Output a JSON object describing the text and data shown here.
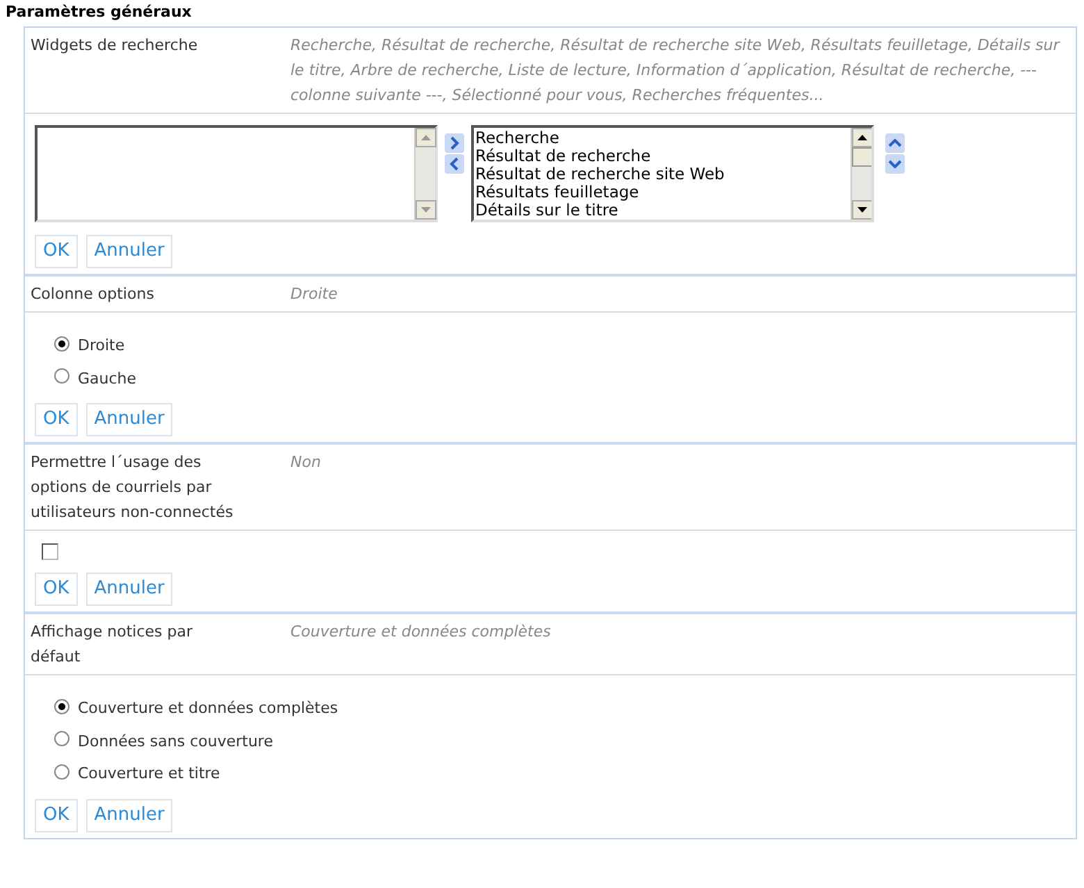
{
  "title": "Paramètres généraux",
  "sections": [
    {
      "label": "Widgets de recherche",
      "summary": "Recherche, Résultat de recherche, Résultat de recherche site Web, Résultats feuilletage, Détails sur le titre, Arbre de recherche, Liste de lecture, Information d´application, Résultat de recherche, ---colonne suivante ---, Sélectionné pour vous, Recherches fréquentes...",
      "editor": {
        "kind": "dual_list",
        "chosen": [
          "Recherche",
          "Résultat de recherche",
          "Résultat de recherche site Web",
          "Résultats feuilletage",
          "Détails sur le titre"
        ]
      },
      "buttons": [
        "OK",
        "Annuler"
      ]
    },
    {
      "label": "Colonne options",
      "summary": "Droite",
      "editor": {
        "kind": "radio",
        "options": [
          {
            "label": "Droite",
            "selected": true
          },
          {
            "label": "Gauche",
            "selected": false
          }
        ]
      },
      "buttons": [
        "OK",
        "Annuler"
      ]
    },
    {
      "label": "Permettre l´usage des options de courriels par utilisateurs non-connectés",
      "summary": "Non",
      "editor": {
        "kind": "checkbox",
        "checked": false
      },
      "buttons": [
        "OK",
        "Annuler"
      ]
    },
    {
      "label": "Affichage notices par défaut",
      "summary": "Couverture et données complètes",
      "editor": {
        "kind": "radio",
        "options": [
          {
            "label": "Couverture et données complètes",
            "selected": true
          },
          {
            "label": "Données sans couverture",
            "selected": false
          },
          {
            "label": "Couverture et titre",
            "selected": false
          }
        ]
      },
      "buttons": [
        "OK",
        "Annuler"
      ]
    }
  ]
}
